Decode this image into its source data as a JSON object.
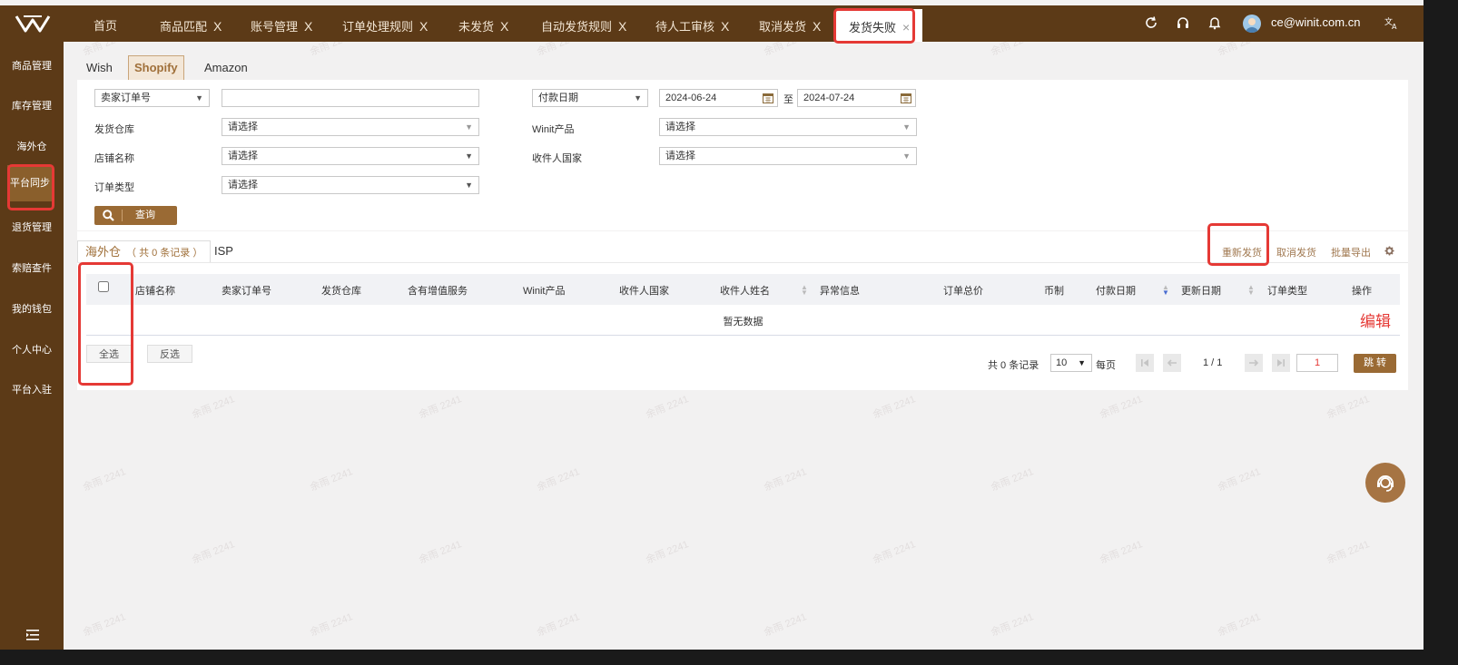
{
  "colors": {
    "brand": "#5c3a17",
    "accent": "#9a6a34",
    "highlight": "#e53935"
  },
  "topbar": {
    "logo": "logo-icon",
    "tabs": [
      {
        "label": "首页",
        "closable": false
      },
      {
        "label": "商品匹配",
        "closable": true
      },
      {
        "label": "账号管理",
        "closable": true
      },
      {
        "label": "订单处理规则",
        "closable": true
      },
      {
        "label": "未发货",
        "closable": true
      },
      {
        "label": "自动发货规则",
        "closable": true
      },
      {
        "label": "待人工审核",
        "closable": true
      },
      {
        "label": "取消发货",
        "closable": true
      },
      {
        "label": "发货失败",
        "closable": true,
        "active": true
      }
    ],
    "close_glyph": "X",
    "close_glyph_active": "×",
    "icons": [
      "refresh-icon",
      "headset-icon",
      "bell-icon",
      "translate-icon"
    ],
    "user_email": "ce@winit.com.cn"
  },
  "sidebar": {
    "items": [
      {
        "label": "商品管理"
      },
      {
        "label": "库存管理"
      },
      {
        "label": "海外仓"
      },
      {
        "label": "平台同步",
        "active": true
      },
      {
        "label": "退货管理"
      },
      {
        "label": "索赔查件"
      },
      {
        "label": "我的钱包"
      },
      {
        "label": "个人中心"
      },
      {
        "label": "平台入驻"
      }
    ],
    "collapse_icon": "menu-collapse-icon"
  },
  "platform_tabs": [
    {
      "label": "Wish"
    },
    {
      "label": "Shopify",
      "active": true
    },
    {
      "label": "Amazon"
    }
  ],
  "filters": {
    "order_no_type": "卖家订单号",
    "order_no_value": "",
    "date_type": "付款日期",
    "date_from": "2024-06-24",
    "date_to_label": "至",
    "date_to": "2024-07-24",
    "warehouse_label": "发货仓库",
    "warehouse_placeholder": "请选择",
    "product_label": "Winit产品",
    "product_placeholder": "请选择",
    "store_label": "店铺名称",
    "store_placeholder": "请选择",
    "country_label": "收件人国家",
    "country_placeholder": "请选择",
    "order_type_label": "订单类型",
    "order_type_placeholder": "请选择",
    "query_button": "查询"
  },
  "results": {
    "tabs": [
      {
        "label": "海外仓",
        "sub": "（ 共 0 条记录 ）",
        "active": true
      },
      {
        "label": "ISP"
      }
    ],
    "actions": {
      "resend": "重新发货",
      "cancel": "取消发货",
      "export": "批量导出",
      "settings_icon": "gear-icon"
    },
    "columns": [
      "店铺名称",
      "卖家订单号",
      "发货仓库",
      "含有增值服务",
      "Winit产品",
      "收件人国家",
      "收件人姓名",
      "异常信息",
      "订单总价",
      "币制",
      "付款日期",
      "更新日期",
      "订单类型",
      "操作"
    ],
    "empty_text": "暂无数据",
    "select_all": "全选",
    "invert_select": "反选",
    "total_text": "共 0 条记录",
    "page_size": "10",
    "per_page_label": "每页",
    "page_info": "1 / 1",
    "page_input": "1",
    "jump_button": "跳 转"
  },
  "annotation": {
    "edit_label": "编辑"
  },
  "watermark": "余雨 2241",
  "help_fab_icon": "customer-service-icon"
}
